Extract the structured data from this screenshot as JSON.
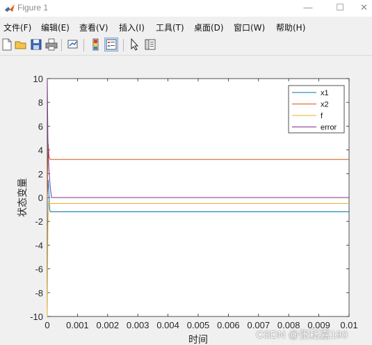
{
  "window": {
    "title": "Figure 1",
    "controls": {
      "minimize": "—",
      "maximize": "☐",
      "close": "✕"
    }
  },
  "menu": [
    "文件(F)",
    "编辑(E)",
    "查看(V)",
    "插入(I)",
    "工具(T)",
    "桌面(D)",
    "窗口(W)",
    "帮助(H)"
  ],
  "toolbar": {
    "icons": [
      "new-figure-icon",
      "open-file-icon",
      "save-icon",
      "print-icon",
      "link-plot-icon",
      "colorbar-icon",
      "legend-icon",
      "edit-plot-arrow-icon",
      "property-inspector-icon"
    ],
    "active": "legend-icon"
  },
  "chart_data": {
    "type": "line",
    "xlabel": "时间",
    "ylabel": "状态变量",
    "xlim": [
      0,
      0.01
    ],
    "ylim": [
      -10,
      10
    ],
    "x_ticks": [
      "0",
      "0.001",
      "0.002",
      "0.003",
      "0.004",
      "0.005",
      "0.006",
      "0.007",
      "0.008",
      "0.009",
      "0.01"
    ],
    "y_ticks": [
      "-10",
      "-8",
      "-6",
      "-4",
      "-2",
      "0",
      "2",
      "4",
      "6",
      "8",
      "10"
    ],
    "grid": false,
    "legend_position": "top-right",
    "series": [
      {
        "name": "x1",
        "color": "#0072bd",
        "x": [
          0,
          3e-05,
          8e-05,
          0.0001,
          0.01
        ],
        "y": [
          0,
          1.5,
          -1.0,
          -1.2,
          -1.2
        ]
      },
      {
        "name": "x2",
        "color": "#d95319",
        "x": [
          0,
          3e-05,
          6e-05,
          0.0001,
          0.01
        ],
        "y": [
          0,
          4.5,
          3.4,
          3.2,
          3.2
        ]
      },
      {
        "name": "f",
        "color": "#edb120",
        "x": [
          0,
          2e-05,
          4e-05,
          8e-05,
          0.01
        ],
        "y": [
          -10,
          -2.5,
          -0.3,
          -0.5,
          -0.5
        ]
      },
      {
        "name": "error",
        "color": "#7e2f8e",
        "x": [
          0,
          2e-05,
          5e-05,
          0.0001,
          0.00014,
          0.01
        ],
        "y": [
          10,
          5,
          2.5,
          0.8,
          0,
          0
        ]
      }
    ]
  },
  "watermark": "CSDN @张耘嘉190"
}
